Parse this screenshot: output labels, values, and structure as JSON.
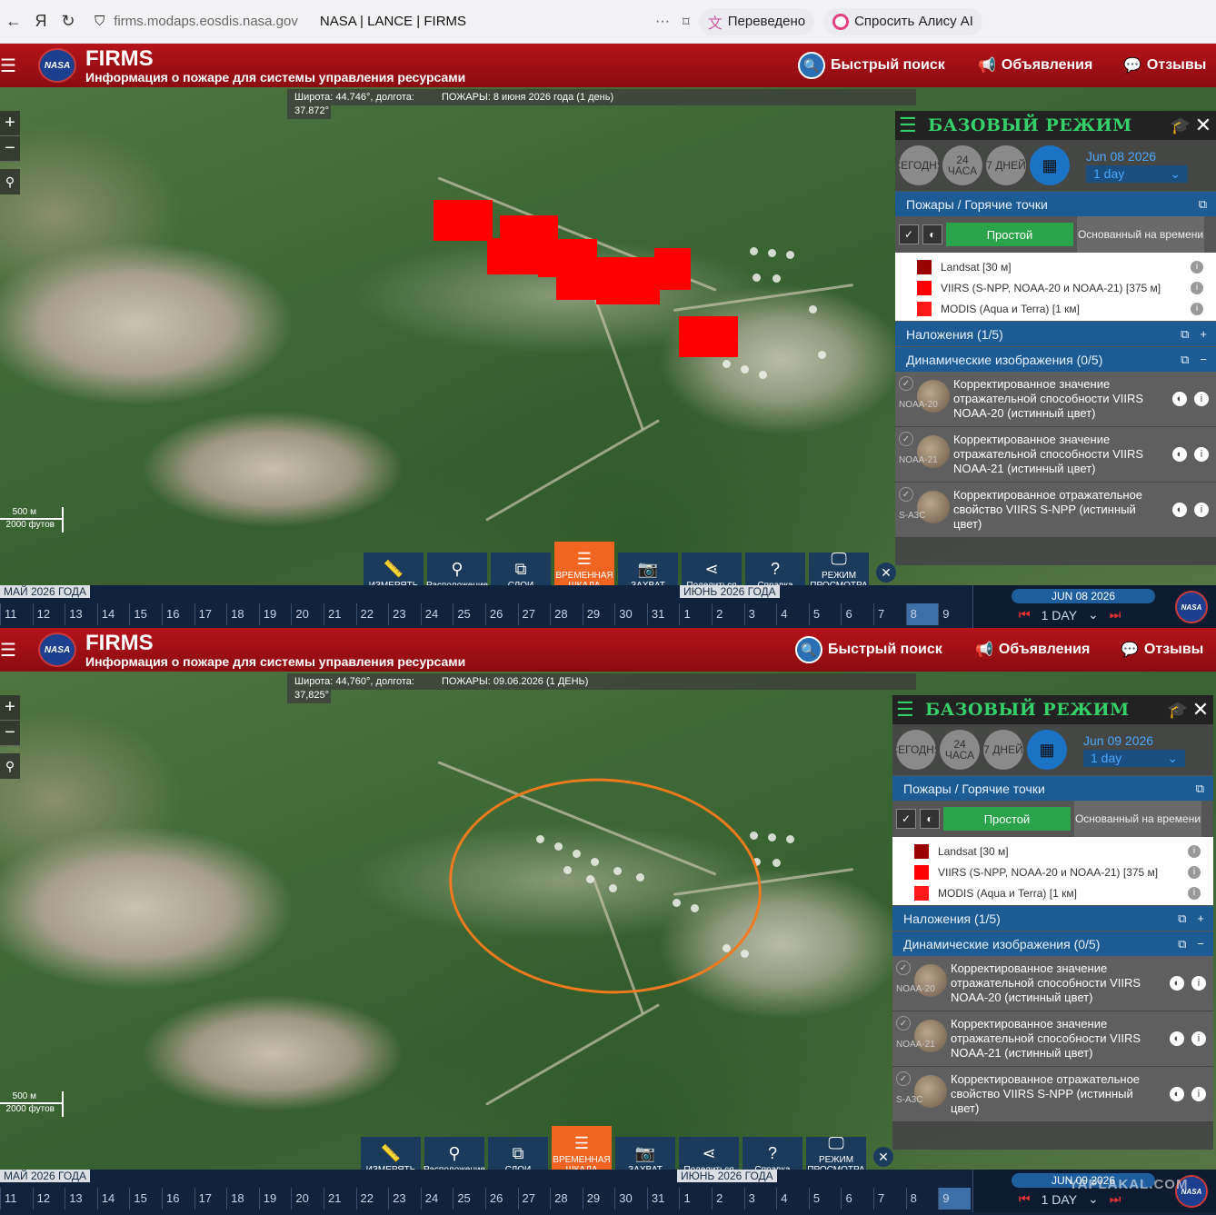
{
  "browser": {
    "url": "firms.modaps.eosdis.nasa.gov",
    "tab_title": "NASA | LANCE | FIRMS",
    "dots": "···",
    "translated_label": "Переведено",
    "alice_label": "Спросить Алису AI"
  },
  "app": {
    "brand": "FIRMS",
    "subtitle": "Информация о пожаре для системы управления ресурсами",
    "nasa": "NASA",
    "quick_search": "Быстрый поиск",
    "announcements": "Объявления",
    "reviews": "Отзывы"
  },
  "panel_common": {
    "mode_title": "БАЗОВЫЙ РЕЖИМ",
    "btn_today": "СЕГОДНЯ",
    "btn_24h": "24 ЧАСА",
    "btn_7d": "7 ДНЕЙ",
    "duration": "1 day",
    "fires_section": "Пожары / Горячие точки",
    "simple_toggle": "Простой",
    "time_toggle": "Основанный на времени",
    "legend": [
      "Landsat [30 м]",
      "VIIRS (S-NPP, NOAA-20 и NOAA-21) [375 м]",
      "MODIS (Aqua и Terra) [1 км]"
    ],
    "overlays": "Наложения (1/5)",
    "dynamic": "Динамические изображения (0/5)",
    "dyn_items": [
      {
        "thumb": "NOAA-20",
        "text": "Корректированное значение отражательной способности VIIRS NOAA-20 (истинный цвет)"
      },
      {
        "thumb": "NOAA-21",
        "text": "Корректированное значение отражательной способности VIIRS NOAA-21 (истинный цвет)"
      },
      {
        "thumb": "S-A3C",
        "text": "Корректированное отражательное свойство VIIRS S-NPP (истинный цвет)"
      }
    ],
    "tools": [
      "ИЗМЕРЯТЬ",
      "Расположение",
      "СЛОИ",
      "ВРЕМЕННАЯ ШКАЛА",
      "ЗАХВАТ",
      "Поделиться",
      "Справка",
      "РЕЖИМ ПРОСМОТРА"
    ],
    "scale_m": "500 м",
    "scale_ft": "2000 футов",
    "month_may": "МАЙ 2026 ГОДА",
    "month_june": "ИЮНЬ 2026 ГОДА",
    "days": [
      "11",
      "12",
      "13",
      "14",
      "15",
      "16",
      "17",
      "18",
      "19",
      "20",
      "21",
      "22",
      "23",
      "24",
      "25",
      "26",
      "27",
      "28",
      "29",
      "30",
      "31",
      "1",
      "2",
      "3",
      "4",
      "5",
      "6",
      "7",
      "8",
      "9"
    ],
    "tl_duration": "1 DAY"
  },
  "panel1": {
    "coords": "Широта: 44.746°, долгота:",
    "coords2": "37.872°",
    "fires_date": "ПОЖАРЫ: 8 июня 2026 года (1 день)",
    "date": "Jun 08 2026",
    "tl_date": "JUN 08 2026"
  },
  "panel2": {
    "coords": "Широта: 44,760°, долгота:",
    "coords2": "37,825°",
    "fires_date": "ПОЖАРЫ: 09.06.2026 (1 ДЕНЬ)",
    "date": "Jun 09 2026",
    "tl_date": "JUN 09 2026",
    "watermark": "YAPLAKAL.COM"
  },
  "colors": {
    "landsat": "#9b0000",
    "viirs": "#ff0000",
    "modis": "#ff1a1a",
    "ellipse": "#f07a1e",
    "header": "#a51016"
  }
}
